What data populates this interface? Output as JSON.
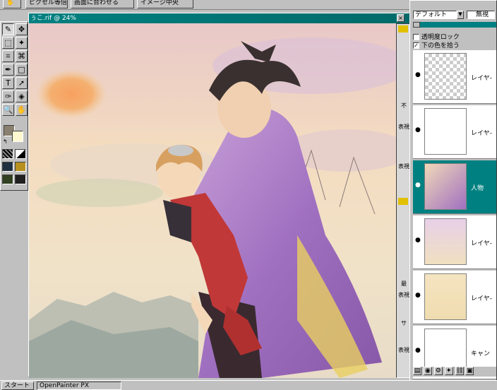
{
  "toolbar": {
    "buttons": [
      "ピクセル等倍",
      "画面に合わせる",
      "イメージ中央"
    ]
  },
  "toolbox": {
    "tools": [
      {
        "name": "pen-tool",
        "glyph": "✎"
      },
      {
        "name": "move-tool",
        "glyph": "✥"
      },
      {
        "name": "marquee-tool",
        "glyph": "⬚"
      },
      {
        "name": "magic-wand-tool",
        "glyph": "✦"
      },
      {
        "name": "crop-tool",
        "glyph": "⌗"
      },
      {
        "name": "lasso-tool",
        "glyph": "⌘"
      },
      {
        "name": "pen-path-tool",
        "glyph": "✒"
      },
      {
        "name": "rectangle-tool",
        "glyph": "□"
      },
      {
        "name": "text-tool",
        "glyph": "T"
      },
      {
        "name": "select-arrow-tool",
        "glyph": "➚"
      },
      {
        "name": "eyedropper-tool",
        "glyph": "✑"
      },
      {
        "name": "fill-tool",
        "glyph": "◈"
      },
      {
        "name": "zoom-tool",
        "glyph": "🔍"
      },
      {
        "name": "hand-tool",
        "glyph": "✋"
      }
    ],
    "fg_color": "#8a8070",
    "bg_color": "#fff8d0"
  },
  "canvas": {
    "title": "ぅこ.rif @ 24%",
    "scroll_labels": [
      "不",
      "表視",
      "表視",
      "最",
      "表視",
      "サ",
      "表視"
    ]
  },
  "layers_panel": {
    "mode": "デフォルト",
    "mode_right": "無視",
    "lock_transparency": "透明度ロック",
    "pick_lower": "下の色を拾う",
    "lock_checked": false,
    "pick_checked": true,
    "layers": [
      {
        "name": "レイヤ-",
        "selected": false
      },
      {
        "name": "レイヤ-",
        "selected": false
      },
      {
        "name": "人物",
        "selected": true
      },
      {
        "name": "レイヤ-",
        "selected": false
      },
      {
        "name": "レイヤ-",
        "selected": false
      },
      {
        "name": "キャン",
        "selected": false
      }
    ]
  },
  "taskbar": {
    "start": "スタート",
    "app": "OpenPainter PX"
  },
  "colors": {
    "title_teal": "#008080",
    "selected_layer": "#008080"
  }
}
